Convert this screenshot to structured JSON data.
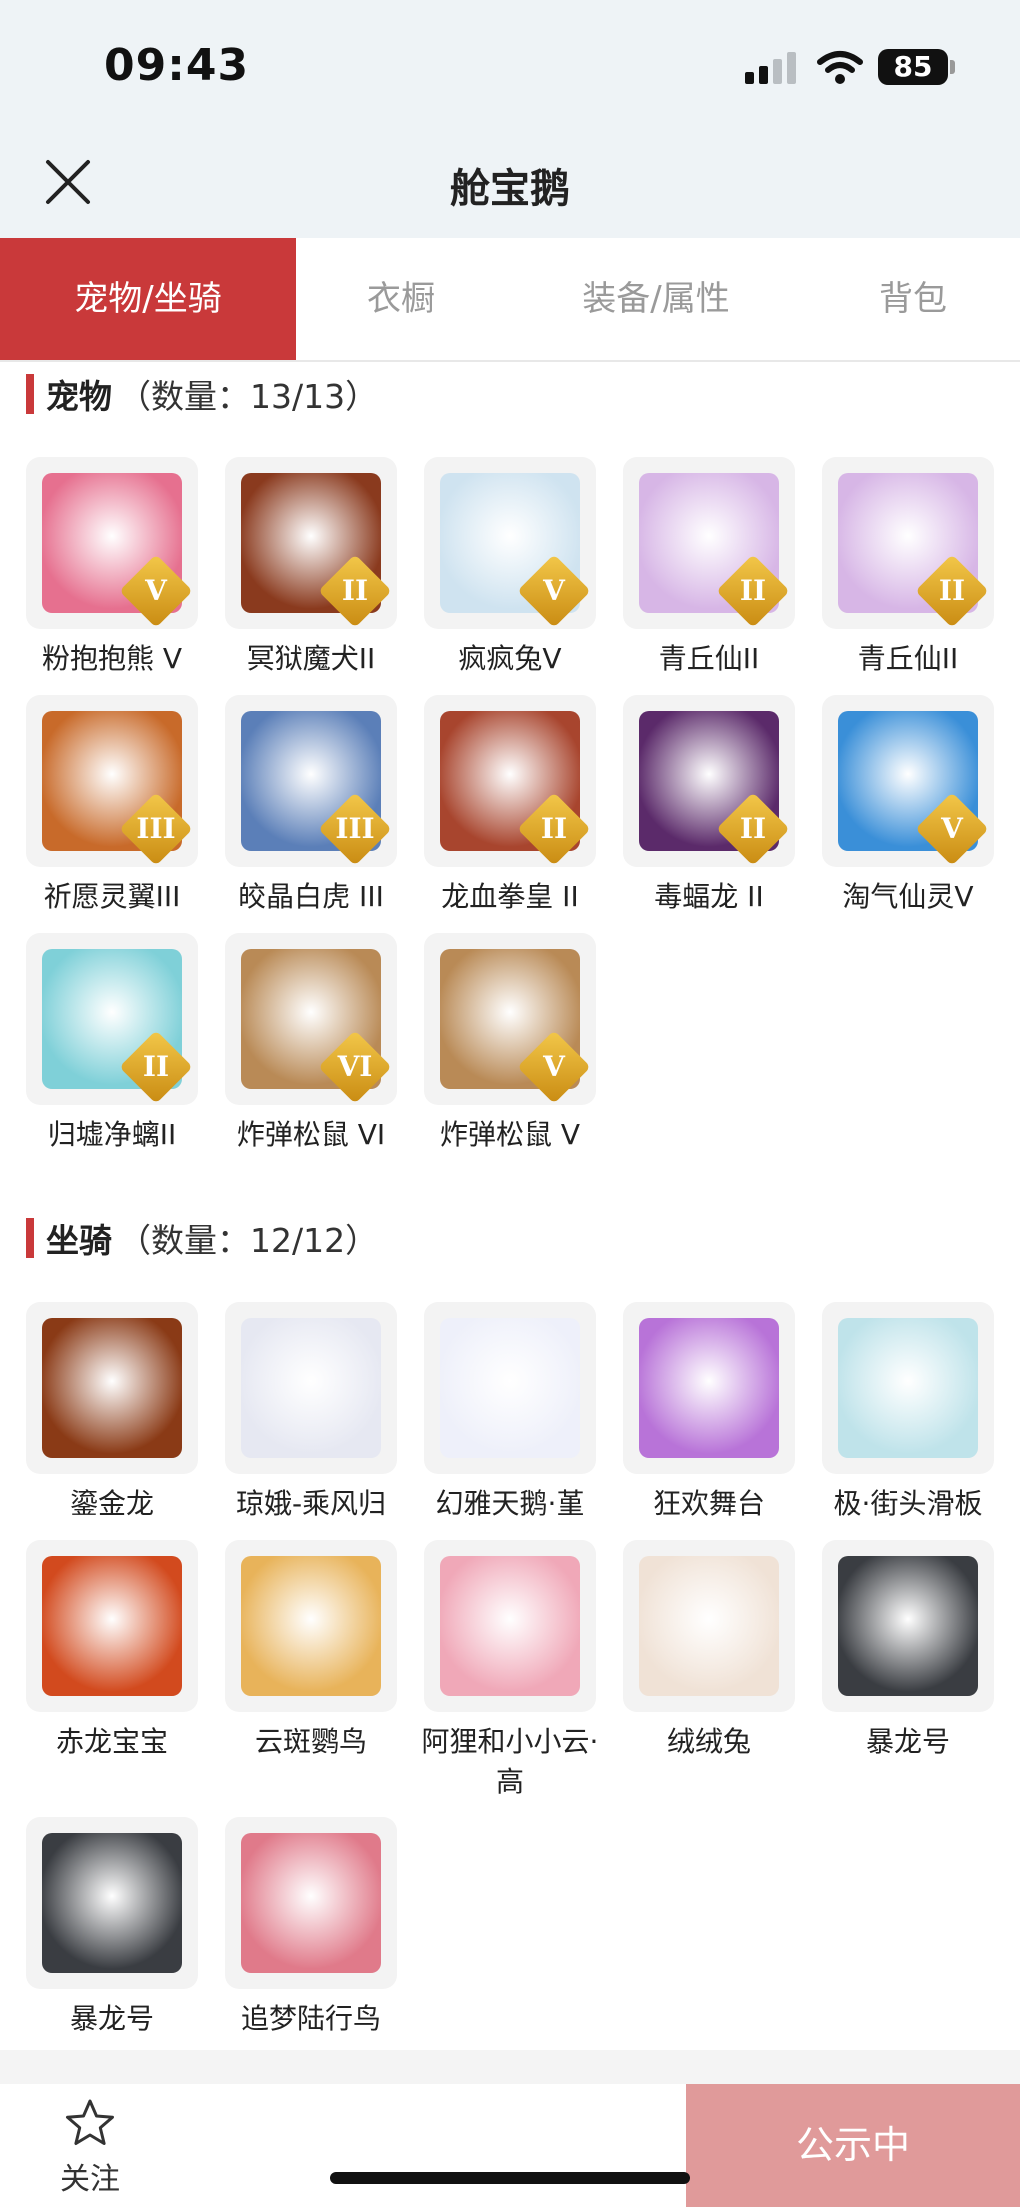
{
  "status": {
    "time": "09:43",
    "battery": "85"
  },
  "nav": {
    "title": "舱宝鹅"
  },
  "tabs": [
    {
      "label": "宠物/坐骑"
    },
    {
      "label": "衣橱"
    },
    {
      "label": "装备/属性"
    },
    {
      "label": "背包"
    }
  ],
  "pets": {
    "title": "宠物",
    "count": "（数量：13/13）",
    "items": [
      {
        "name": "粉抱抱熊 V",
        "badge": "V",
        "color": "#e6708f"
      },
      {
        "name": "冥狱魔犬II",
        "badge": "II",
        "color": "#8a3a1e"
      },
      {
        "name": "疯疯兔V",
        "badge": "V",
        "color": "#cfe3f0"
      },
      {
        "name": "青丘仙II",
        "badge": "II",
        "color": "#d7b6e6"
      },
      {
        "name": "青丘仙II",
        "badge": "II",
        "color": "#d7b6e6"
      },
      {
        "name": "祈愿灵翼III",
        "badge": "III",
        "color": "#c86a2a"
      },
      {
        "name": "皎晶白虎 III",
        "badge": "III",
        "color": "#5b7fb8"
      },
      {
        "name": "龙血拳皇 II",
        "badge": "II",
        "color": "#a8452e"
      },
      {
        "name": "毒蝠龙 II",
        "badge": "II",
        "color": "#5b2a6a"
      },
      {
        "name": "淘气仙灵V",
        "badge": "V",
        "color": "#3a8fd8"
      },
      {
        "name": "归墟净螭II",
        "badge": "II",
        "color": "#7fd0d8"
      },
      {
        "name": "炸弹松鼠 VI",
        "badge": "VI",
        "color": "#b98a56"
      },
      {
        "name": "炸弹松鼠 V",
        "badge": "V",
        "color": "#b98a56"
      }
    ]
  },
  "mounts": {
    "title": "坐骑",
    "count": "（数量：12/12）",
    "items": [
      {
        "name": "鎏金龙",
        "color": "#8a3a16"
      },
      {
        "name": "琼娥-乘风归",
        "color": "#e6e8f2"
      },
      {
        "name": "幻雅天鹅·堇",
        "color": "#eef0fa"
      },
      {
        "name": "狂欢舞台",
        "color": "#b873d8"
      },
      {
        "name": "极·街头滑板",
        "color": "#bfe3ea"
      },
      {
        "name": "赤龙宝宝",
        "color": "#d24a1e"
      },
      {
        "name": "云斑鹦鸟",
        "color": "#e8b35a"
      },
      {
        "name": "阿狸和小小云·高",
        "color": "#f0a8b8"
      },
      {
        "name": "绒绒兔",
        "color": "#f0e2d6"
      },
      {
        "name": "暴龙号",
        "color": "#3a3d42"
      },
      {
        "name": "暴龙号",
        "color": "#3a3d42"
      },
      {
        "name": "追梦陆行鸟",
        "color": "#e07a8a"
      }
    ]
  },
  "bottom": {
    "follow": "关注",
    "public": "公示中"
  },
  "colors": {
    "accent": "#c9393a",
    "public_button": "#e09a9a"
  }
}
